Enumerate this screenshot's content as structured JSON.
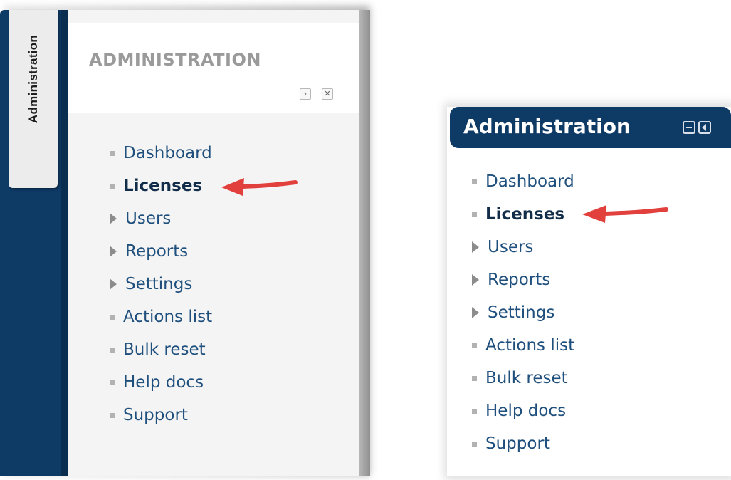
{
  "left": {
    "dock_tab_label": "Administration",
    "title": "ADMINISTRATION",
    "buttons": {
      "move": "›",
      "close": "✕"
    }
  },
  "right": {
    "title": "Administration"
  },
  "menu": [
    {
      "label": "Dashboard",
      "kind": "leaf"
    },
    {
      "label": "Licenses",
      "kind": "leaf",
      "emphasized": true
    },
    {
      "label": "Users",
      "kind": "branch"
    },
    {
      "label": "Reports",
      "kind": "branch"
    },
    {
      "label": "Settings",
      "kind": "branch"
    },
    {
      "label": "Actions list",
      "kind": "leaf"
    },
    {
      "label": "Bulk reset",
      "kind": "leaf"
    },
    {
      "label": "Help docs",
      "kind": "leaf"
    },
    {
      "label": "Support",
      "kind": "leaf"
    }
  ],
  "colors": {
    "navy": "#0e3a66",
    "link": "#1f4f7d",
    "arrow": "#e2403c"
  }
}
